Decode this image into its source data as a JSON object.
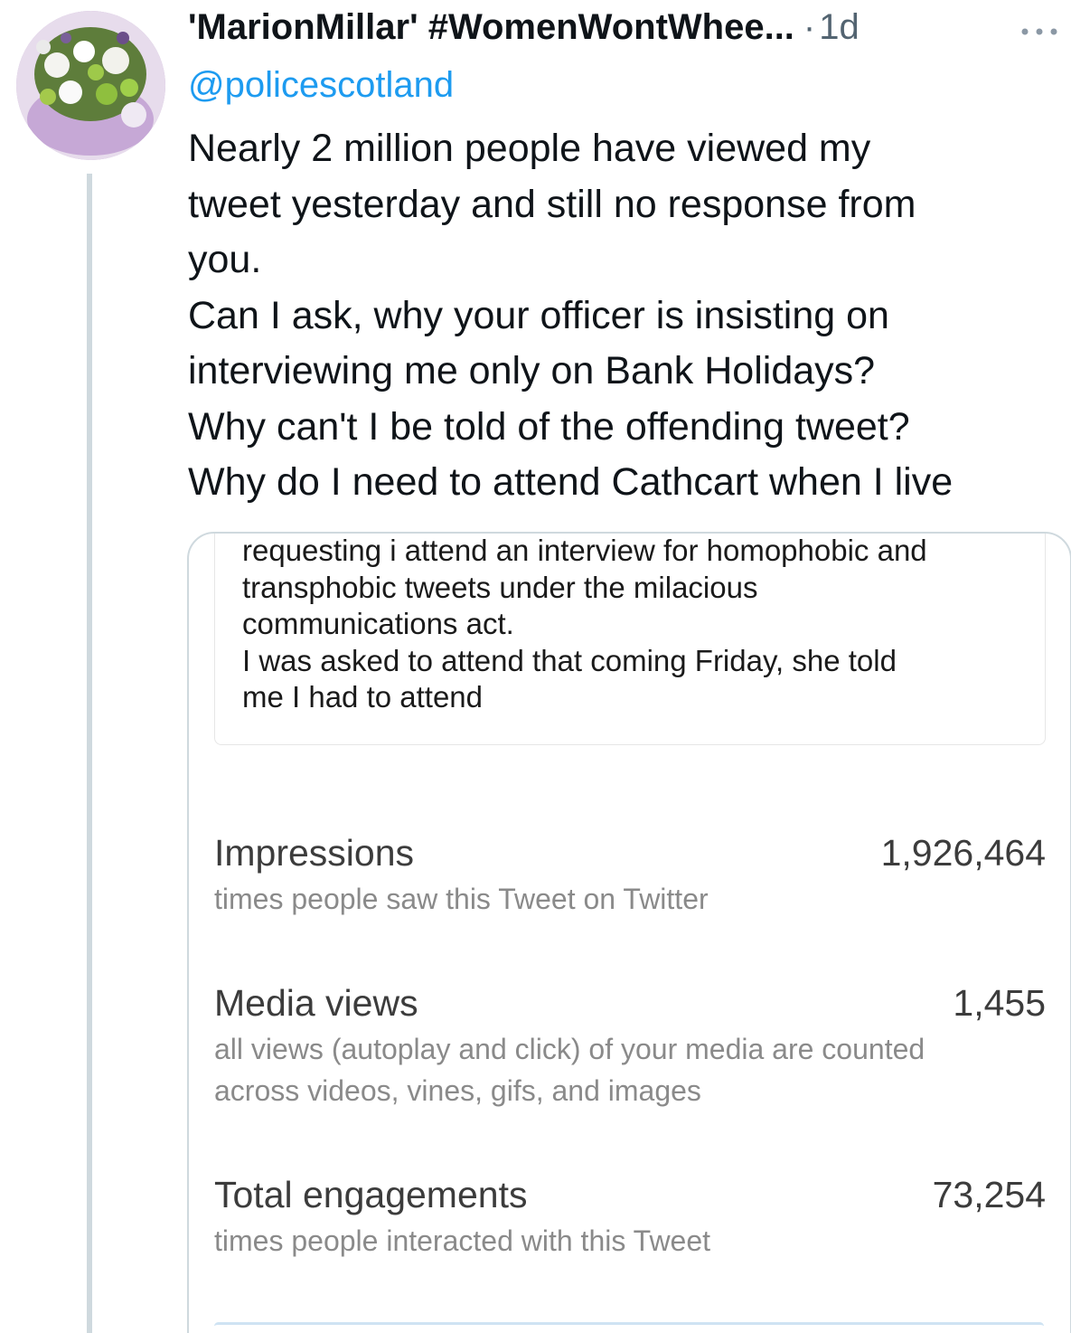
{
  "tweet": {
    "display_name": "'MarionMillar' #WomenWontWhee...",
    "separator": "·",
    "timestamp": "1d",
    "mention": "@policescotland",
    "text_lines": [
      "Nearly 2 million people have viewed my",
      "tweet yesterday and still no response from",
      "you.",
      "Can I ask, why your officer is insisting on",
      "interviewing me only on Bank Holidays?",
      "Why can't I be told of the offending tweet?",
      "Why do I need to attend Cathcart when I live"
    ],
    "avatar_icon": "bouquet-avatar",
    "more_icon": "more-horizontal-icon"
  },
  "media": {
    "quoted_lines": [
      "requesting i attend an interview for homophobic and",
      "transphobic tweets under the milacious",
      "communications act.",
      "I was asked to attend that coming Friday, she told",
      "me I had to attend"
    ],
    "stats": [
      {
        "label": "Impressions",
        "value": "1,926,464",
        "desc_lines": [
          "times people saw this Tweet on Twitter"
        ]
      },
      {
        "label": "Media views",
        "value": "1,455",
        "desc_lines": [
          "all views (autoplay and click) of your media are counted",
          "across videos, vines, gifs, and images"
        ]
      },
      {
        "label": "Total engagements",
        "value": "73,254",
        "desc_lines": [
          "times people interacted with this Tweet"
        ]
      }
    ]
  },
  "colors": {
    "link": "#1d9bf0",
    "secondary_text": "#536471",
    "thread_line": "#cfd9de"
  }
}
